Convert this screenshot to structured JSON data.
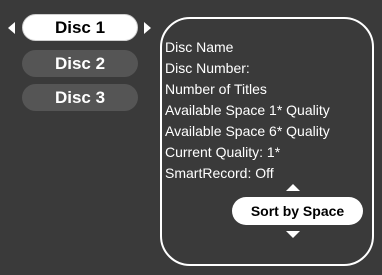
{
  "discs": {
    "items": [
      {
        "label": "Disc 1",
        "selected": true
      },
      {
        "label": "Disc 2",
        "selected": false
      },
      {
        "label": "Disc 3",
        "selected": false
      }
    ]
  },
  "info": {
    "lines": [
      "Disc Name",
      "Disc Number:",
      "Number of Titles",
      "Available Space 1* Quality",
      "Available Space 6* Quality",
      "Current Quality: 1*",
      "SmartRecord: Off"
    ]
  },
  "sort": {
    "label": "Sort by Space"
  },
  "colors": {
    "background": "#3a3a3a",
    "selected_tab": "#ffffff",
    "inactive_tab": "#555555",
    "text": "#ffffff"
  },
  "icons": [
    "arrow-left-icon",
    "arrow-right-icon",
    "arrow-up-icon",
    "arrow-down-icon"
  ]
}
